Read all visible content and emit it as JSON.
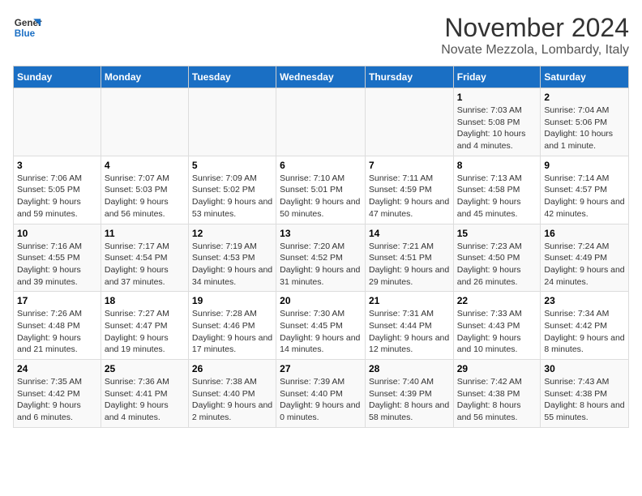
{
  "logo": {
    "line1": "General",
    "line2": "Blue"
  },
  "header": {
    "month": "November 2024",
    "location": "Novate Mezzola, Lombardy, Italy"
  },
  "weekdays": [
    "Sunday",
    "Monday",
    "Tuesday",
    "Wednesday",
    "Thursday",
    "Friday",
    "Saturday"
  ],
  "weeks": [
    [
      {
        "day": "",
        "info": ""
      },
      {
        "day": "",
        "info": ""
      },
      {
        "day": "",
        "info": ""
      },
      {
        "day": "",
        "info": ""
      },
      {
        "day": "",
        "info": ""
      },
      {
        "day": "1",
        "info": "Sunrise: 7:03 AM\nSunset: 5:08 PM\nDaylight: 10 hours and 4 minutes."
      },
      {
        "day": "2",
        "info": "Sunrise: 7:04 AM\nSunset: 5:06 PM\nDaylight: 10 hours and 1 minute."
      }
    ],
    [
      {
        "day": "3",
        "info": "Sunrise: 7:06 AM\nSunset: 5:05 PM\nDaylight: 9 hours and 59 minutes."
      },
      {
        "day": "4",
        "info": "Sunrise: 7:07 AM\nSunset: 5:03 PM\nDaylight: 9 hours and 56 minutes."
      },
      {
        "day": "5",
        "info": "Sunrise: 7:09 AM\nSunset: 5:02 PM\nDaylight: 9 hours and 53 minutes."
      },
      {
        "day": "6",
        "info": "Sunrise: 7:10 AM\nSunset: 5:01 PM\nDaylight: 9 hours and 50 minutes."
      },
      {
        "day": "7",
        "info": "Sunrise: 7:11 AM\nSunset: 4:59 PM\nDaylight: 9 hours and 47 minutes."
      },
      {
        "day": "8",
        "info": "Sunrise: 7:13 AM\nSunset: 4:58 PM\nDaylight: 9 hours and 45 minutes."
      },
      {
        "day": "9",
        "info": "Sunrise: 7:14 AM\nSunset: 4:57 PM\nDaylight: 9 hours and 42 minutes."
      }
    ],
    [
      {
        "day": "10",
        "info": "Sunrise: 7:16 AM\nSunset: 4:55 PM\nDaylight: 9 hours and 39 minutes."
      },
      {
        "day": "11",
        "info": "Sunrise: 7:17 AM\nSunset: 4:54 PM\nDaylight: 9 hours and 37 minutes."
      },
      {
        "day": "12",
        "info": "Sunrise: 7:19 AM\nSunset: 4:53 PM\nDaylight: 9 hours and 34 minutes."
      },
      {
        "day": "13",
        "info": "Sunrise: 7:20 AM\nSunset: 4:52 PM\nDaylight: 9 hours and 31 minutes."
      },
      {
        "day": "14",
        "info": "Sunrise: 7:21 AM\nSunset: 4:51 PM\nDaylight: 9 hours and 29 minutes."
      },
      {
        "day": "15",
        "info": "Sunrise: 7:23 AM\nSunset: 4:50 PM\nDaylight: 9 hours and 26 minutes."
      },
      {
        "day": "16",
        "info": "Sunrise: 7:24 AM\nSunset: 4:49 PM\nDaylight: 9 hours and 24 minutes."
      }
    ],
    [
      {
        "day": "17",
        "info": "Sunrise: 7:26 AM\nSunset: 4:48 PM\nDaylight: 9 hours and 21 minutes."
      },
      {
        "day": "18",
        "info": "Sunrise: 7:27 AM\nSunset: 4:47 PM\nDaylight: 9 hours and 19 minutes."
      },
      {
        "day": "19",
        "info": "Sunrise: 7:28 AM\nSunset: 4:46 PM\nDaylight: 9 hours and 17 minutes."
      },
      {
        "day": "20",
        "info": "Sunrise: 7:30 AM\nSunset: 4:45 PM\nDaylight: 9 hours and 14 minutes."
      },
      {
        "day": "21",
        "info": "Sunrise: 7:31 AM\nSunset: 4:44 PM\nDaylight: 9 hours and 12 minutes."
      },
      {
        "day": "22",
        "info": "Sunrise: 7:33 AM\nSunset: 4:43 PM\nDaylight: 9 hours and 10 minutes."
      },
      {
        "day": "23",
        "info": "Sunrise: 7:34 AM\nSunset: 4:42 PM\nDaylight: 9 hours and 8 minutes."
      }
    ],
    [
      {
        "day": "24",
        "info": "Sunrise: 7:35 AM\nSunset: 4:42 PM\nDaylight: 9 hours and 6 minutes."
      },
      {
        "day": "25",
        "info": "Sunrise: 7:36 AM\nSunset: 4:41 PM\nDaylight: 9 hours and 4 minutes."
      },
      {
        "day": "26",
        "info": "Sunrise: 7:38 AM\nSunset: 4:40 PM\nDaylight: 9 hours and 2 minutes."
      },
      {
        "day": "27",
        "info": "Sunrise: 7:39 AM\nSunset: 4:40 PM\nDaylight: 9 hours and 0 minutes."
      },
      {
        "day": "28",
        "info": "Sunrise: 7:40 AM\nSunset: 4:39 PM\nDaylight: 8 hours and 58 minutes."
      },
      {
        "day": "29",
        "info": "Sunrise: 7:42 AM\nSunset: 4:38 PM\nDaylight: 8 hours and 56 minutes."
      },
      {
        "day": "30",
        "info": "Sunrise: 7:43 AM\nSunset: 4:38 PM\nDaylight: 8 hours and 55 minutes."
      }
    ]
  ]
}
